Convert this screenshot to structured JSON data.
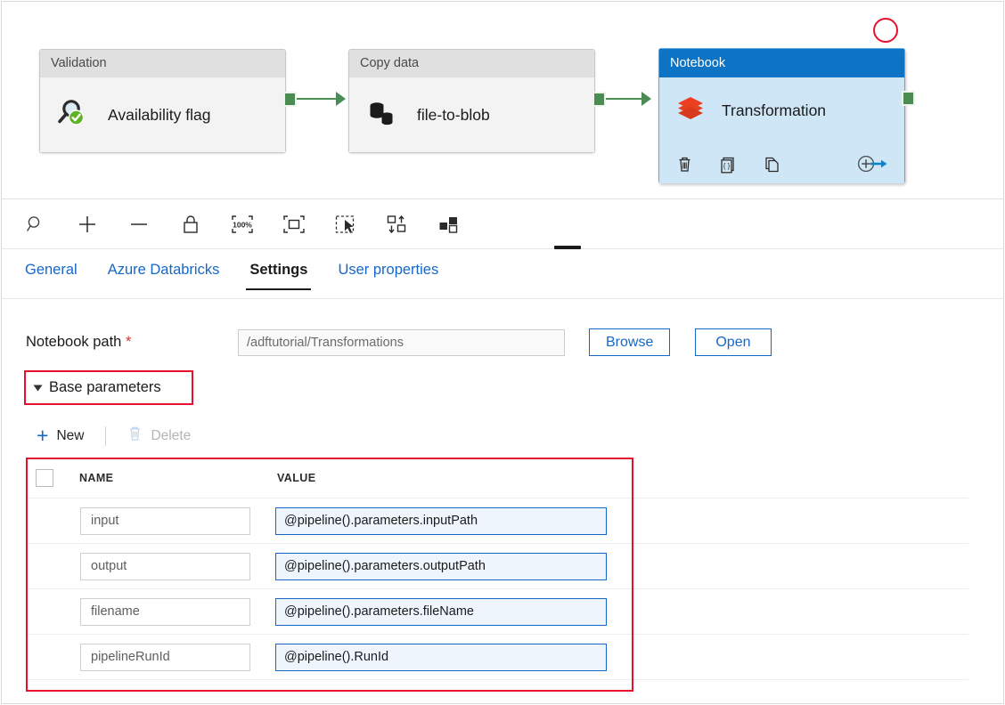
{
  "canvas": {
    "activities": [
      {
        "type_label": "Validation",
        "name": "Availability flag",
        "icon": "magnifier-check-icon",
        "selected": false
      },
      {
        "type_label": "Copy data",
        "name": "file-to-blob",
        "icon": "database-copy-icon",
        "selected": false
      },
      {
        "type_label": "Notebook",
        "name": "Transformation",
        "icon": "databricks-layers-icon",
        "selected": true
      }
    ],
    "selected_actions": [
      {
        "name": "delete",
        "icon": "trash-icon"
      },
      {
        "name": "code",
        "icon": "code-braces-icon"
      },
      {
        "name": "clone",
        "icon": "copy-pages-icon"
      },
      {
        "name": "add-output",
        "icon": "add-output-arrow-icon"
      }
    ],
    "annotation": {
      "shape": "circle",
      "color": "#e8112d"
    },
    "connector_color": "#4a8c52"
  },
  "toolbar": {
    "buttons": [
      {
        "name": "zoom-search",
        "icon": "magnifier-icon",
        "tooltip": "Zoom"
      },
      {
        "name": "zoom-in",
        "icon": "plus-icon",
        "tooltip": "Zoom in"
      },
      {
        "name": "zoom-out",
        "icon": "minus-icon",
        "tooltip": "Zoom out"
      },
      {
        "name": "lock-canvas",
        "icon": "lock-icon",
        "tooltip": "Lock canvas"
      },
      {
        "name": "zoom-100",
        "icon": "zoom-100-percent-icon",
        "tooltip": "100%"
      },
      {
        "name": "zoom-to-fit",
        "icon": "fit-to-screen-icon",
        "tooltip": "Zoom to fit"
      },
      {
        "name": "select-mode",
        "icon": "pointer-select-icon",
        "tooltip": "Select"
      },
      {
        "name": "auto-align-vertical",
        "icon": "auto-align-vertical-icon",
        "tooltip": "Auto align vertical"
      },
      {
        "name": "auto-align-horizontal",
        "icon": "auto-align-horizontal-icon",
        "tooltip": "Auto align horizontal"
      }
    ],
    "zoom_level_label": "100%"
  },
  "tabs": [
    {
      "label": "General",
      "active": false
    },
    {
      "label": "Azure Databricks",
      "active": false
    },
    {
      "label": "Settings",
      "active": true
    },
    {
      "label": "User properties",
      "active": false
    }
  ],
  "settings": {
    "notebook_path": {
      "label": "Notebook path",
      "required_marker": "*",
      "value": "/adftutorial/Transformations",
      "placeholder": "/adftutorial/Transformations"
    },
    "browse_button": "Browse",
    "open_button": "Open",
    "base_parameters": {
      "section_title": "Base parameters",
      "new_button": "New",
      "delete_button": "Delete",
      "delete_disabled": true,
      "columns": [
        "NAME",
        "VALUE"
      ],
      "rows": [
        {
          "name": "input",
          "value": "@pipeline().parameters.inputPath"
        },
        {
          "name": "output",
          "value": "@pipeline().parameters.outputPath"
        },
        {
          "name": "filename",
          "value": "@pipeline().parameters.fileName"
        },
        {
          "name": "pipelineRunId",
          "value": "@pipeline().RunId"
        }
      ]
    }
  },
  "colors": {
    "accent_blue": "#1667c8",
    "selected_header": "#0d73c4",
    "selected_body": "#cfe6f7",
    "connector_green": "#4a8c52",
    "annotation_red": "#e8112d",
    "databricks_red": "#e8401f"
  }
}
